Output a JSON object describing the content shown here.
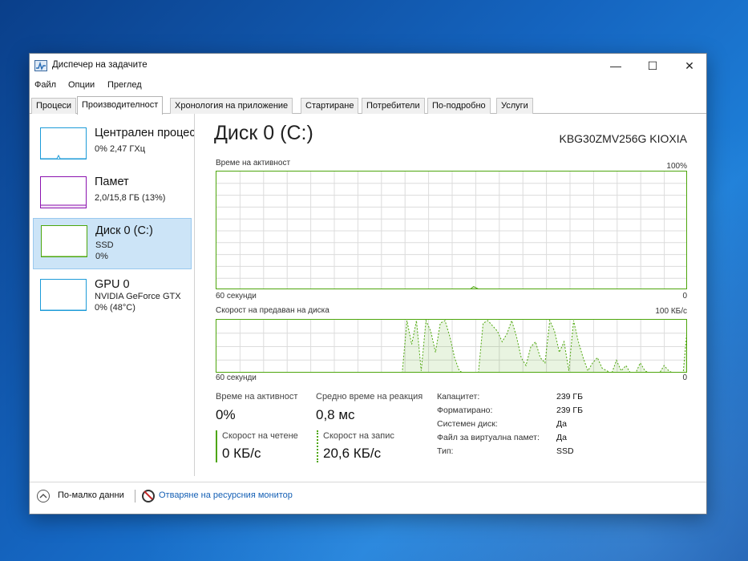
{
  "window": {
    "title": "Диспечер на задачите",
    "controls": {
      "minimize": "—",
      "maximize": "☐",
      "close": "✕"
    }
  },
  "menu": [
    "Файл",
    "Опции",
    "Преглед"
  ],
  "tabs": [
    {
      "label": "Процеси",
      "active": false
    },
    {
      "label": "Производителност",
      "active": true
    },
    {
      "label": "Хронология на приложение",
      "active": false
    },
    {
      "label": "Стартиране",
      "active": false
    },
    {
      "label": "Потребители",
      "active": false
    },
    {
      "label": "По-подробно",
      "active": false
    },
    {
      "label": "Услуги",
      "active": false
    }
  ],
  "resources": [
    {
      "name": "Централен процесор",
      "line1": "0% 2,47 ГХц",
      "line2": ""
    },
    {
      "name": "Памет",
      "line1": "2,0/15,8 ГБ (13%)",
      "line2": ""
    },
    {
      "name": "Диск 0 (C:)",
      "line1": "SSD",
      "line2": "0%",
      "selected": true
    },
    {
      "name": "GPU 0",
      "line1": "NVIDIA GeForce GTX",
      "line2": "0% (48°C)"
    }
  ],
  "disk": {
    "title": "Диск 0 (C:)",
    "model": "KBG30ZMV256G KIOXIA",
    "activity_graph": {
      "label": "Време на активност",
      "max_label": "100%",
      "time_label": "60 секунди",
      "min_label": "0",
      "values": [
        0,
        0,
        0,
        0,
        0,
        0,
        0,
        0,
        0,
        0,
        0,
        0,
        0,
        0,
        0,
        0,
        0,
        0,
        0,
        0,
        0,
        0,
        0,
        0,
        0,
        0,
        0,
        0,
        0,
        0,
        0,
        0,
        0,
        0,
        0,
        0,
        0,
        0,
        0,
        0,
        0,
        0,
        0,
        0,
        0,
        0,
        0,
        0,
        0,
        0,
        0,
        0,
        0,
        0,
        3,
        1,
        0,
        0,
        0,
        1,
        1,
        0,
        0,
        0,
        0,
        0,
        0,
        0,
        0,
        0,
        0,
        0,
        0,
        0,
        0,
        0,
        0,
        0,
        0,
        0,
        0,
        0,
        0,
        0,
        0,
        0,
        0,
        0,
        0,
        0,
        0,
        0,
        0,
        0,
        0,
        0,
        0,
        0,
        0,
        0
      ]
    },
    "transfer_graph": {
      "label": "Скорост на предаван на диска",
      "max_label": "100 КБ/с",
      "time_label": "60 секунди",
      "min_label": "0",
      "write_values": [
        0,
        0,
        0,
        0,
        0,
        0,
        0,
        0,
        0,
        0,
        0,
        0,
        0,
        0,
        0,
        0,
        0,
        0,
        0,
        0,
        0,
        0,
        0,
        0,
        0,
        0,
        0,
        0,
        0,
        0,
        0,
        0,
        0,
        0,
        0,
        0,
        0,
        0,
        0,
        0,
        100,
        55,
        100,
        5,
        100,
        80,
        40,
        95,
        100,
        70,
        30,
        5,
        0,
        0,
        0,
        0,
        95,
        100,
        90,
        80,
        60,
        75,
        100,
        70,
        30,
        15,
        50,
        60,
        30,
        20,
        100,
        80,
        40,
        60,
        5,
        100,
        60,
        30,
        5,
        20,
        30,
        10,
        5,
        0,
        25,
        5,
        15,
        0,
        0,
        20,
        5,
        0,
        0,
        0,
        15,
        5,
        0,
        0,
        0,
        100
      ],
      "read_values": [
        0,
        0,
        0,
        0,
        0,
        0,
        0,
        0,
        0,
        0,
        0,
        0,
        0,
        0,
        0,
        0,
        0,
        0,
        0,
        0,
        0,
        0,
        0,
        0,
        0,
        0,
        0,
        0,
        0,
        0,
        0,
        0,
        0,
        0,
        0,
        0,
        0,
        0,
        0,
        0,
        0,
        0,
        0,
        0,
        0,
        0,
        0,
        0,
        0,
        0,
        0,
        0,
        0,
        0,
        0,
        0,
        0,
        0,
        0,
        0,
        0,
        0,
        0,
        0,
        0,
        0,
        0,
        0,
        0,
        0,
        0,
        0,
        0,
        0,
        0,
        0,
        0,
        0,
        0,
        0,
        0,
        0,
        0,
        0,
        0,
        0,
        0,
        0,
        0,
        0,
        0,
        0,
        0,
        0,
        0,
        0,
        0,
        0,
        0,
        0
      ]
    },
    "stats": {
      "activity_label": "Време на активност",
      "activity_value": "0%",
      "response_label": "Средно време на реакция",
      "response_value": "0,8 мс",
      "read_label": "Скорост на четене",
      "read_value": "0 КБ/с",
      "write_label": "Скорост на запис",
      "write_value": "20,6 КБ/с"
    },
    "properties": [
      {
        "label": "Капацитет:",
        "value": "239 ГБ"
      },
      {
        "label": "Форматирано:",
        "value": "239 ГБ"
      },
      {
        "label": "Системен диск:",
        "value": "Да"
      },
      {
        "label": "Файл за виртуална памет:",
        "value": "Да"
      },
      {
        "label": "Тип:",
        "value": "SSD"
      }
    ]
  },
  "footer": {
    "fewer_details": "По-малко данни",
    "open_monitor": "Отваряне на ресурсния монитор"
  },
  "colors": {
    "disk_accent": "#4da60c",
    "cpu_accent": "#1d9bd8",
    "memory_accent": "#8b12ae",
    "selection": "#cce4f7"
  }
}
